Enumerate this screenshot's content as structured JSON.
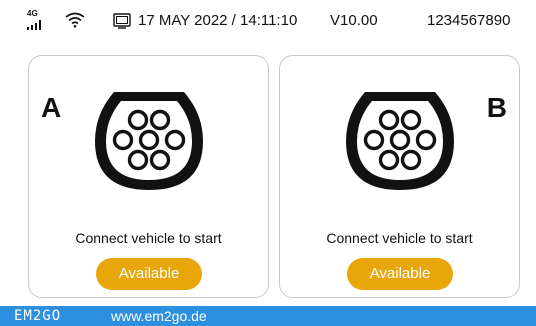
{
  "status_bar": {
    "network_label": "4G",
    "datetime": "17 MAY 2022 / 14:11:10",
    "version": "V10.00",
    "serial": "1234567890",
    "icons": [
      "signal-4g-icon",
      "wifi-icon",
      "display-icon"
    ]
  },
  "ports": [
    {
      "letter": "A",
      "icon": "type2-connector-icon",
      "message": "Connect vehicle to start",
      "status": "Available"
    },
    {
      "letter": "B",
      "icon": "type2-connector-icon",
      "message": "Connect vehicle to start",
      "status": "Available"
    }
  ],
  "footer": {
    "logo": "EM2GO",
    "url": "www.em2go.de"
  },
  "colors": {
    "available": "#e8a60b",
    "footer_bg": "#2c8fe0",
    "card_border": "#c9c9c9"
  }
}
